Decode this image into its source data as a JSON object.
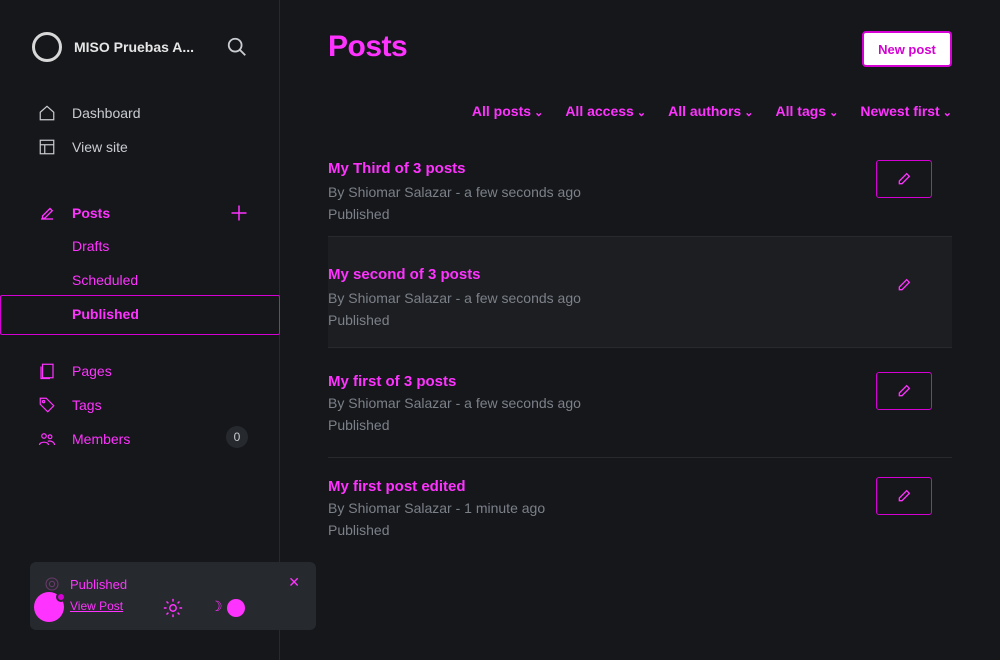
{
  "brand": {
    "name": "MISO Pruebas A..."
  },
  "sidebar": {
    "items": [
      {
        "label": "Dashboard",
        "icon": "home-icon"
      },
      {
        "label": "View site",
        "icon": "layout-icon"
      },
      {
        "label": "Posts",
        "icon": "edit-icon"
      },
      {
        "label": "Pages",
        "icon": "pages-icon"
      },
      {
        "label": "Tags",
        "icon": "tag-icon"
      },
      {
        "label": "Members",
        "icon": "members-icon",
        "count": "0"
      }
    ],
    "sub_items": [
      "Drafts",
      "Scheduled",
      "Published"
    ]
  },
  "main": {
    "title": "Posts",
    "new_post_label": "New post",
    "filters": [
      "All posts",
      "All access",
      "All authors",
      "All tags",
      "Newest first"
    ]
  },
  "posts": [
    {
      "title": "My Third of 3 posts",
      "meta": "By Shiomar Salazar - a few seconds ago",
      "status": "Published"
    },
    {
      "title": "My second of 3 posts",
      "meta": "By Shiomar Salazar - a few seconds ago",
      "status": "Published"
    },
    {
      "title": "My first of 3 posts",
      "meta": "By Shiomar Salazar - a few seconds ago",
      "status": "Published"
    },
    {
      "title": "My first post edited",
      "meta": "By Shiomar Salazar - 1 minute ago",
      "status": "Published"
    }
  ],
  "toast": {
    "title": "Published",
    "link": "View Post"
  },
  "colors": {
    "accent": "#ff33ff",
    "background": "#15171b"
  }
}
